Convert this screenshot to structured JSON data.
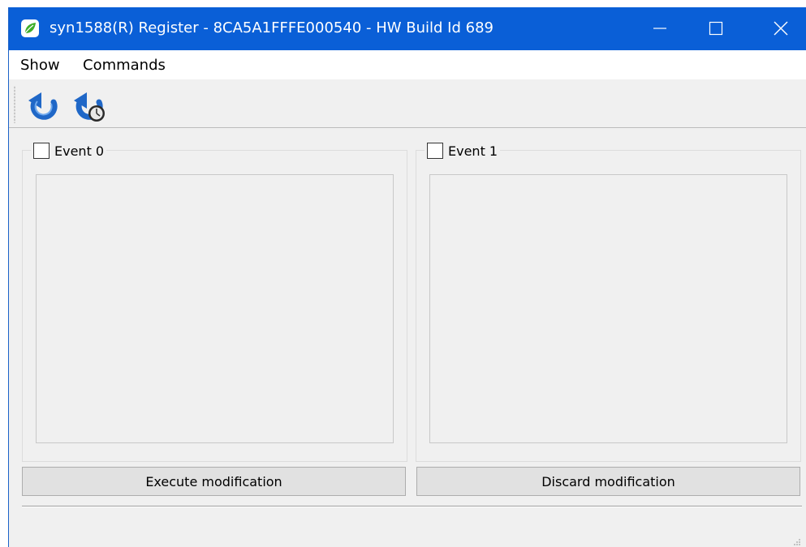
{
  "window": {
    "title": "syn1588(R) Register - 8CA5A1FFFE000540 - HW Build Id 689",
    "app_icon": "leaf-icon",
    "controls": [
      "minimize-icon",
      "maximize-icon",
      "close-icon"
    ],
    "title_bar_color": "#0a5fd7"
  },
  "menubar": {
    "items": [
      {
        "label": "Show"
      },
      {
        "label": "Commands"
      }
    ]
  },
  "toolbar": {
    "buttons": [
      {
        "icon": "refresh-icon"
      },
      {
        "icon": "auto-refresh-timer-icon"
      }
    ]
  },
  "events": [
    {
      "label": "Event 0",
      "checked": false
    },
    {
      "label": "Event 1",
      "checked": false
    }
  ],
  "actions": {
    "execute_label": "Execute modification",
    "discard_label": "Discard modification"
  }
}
